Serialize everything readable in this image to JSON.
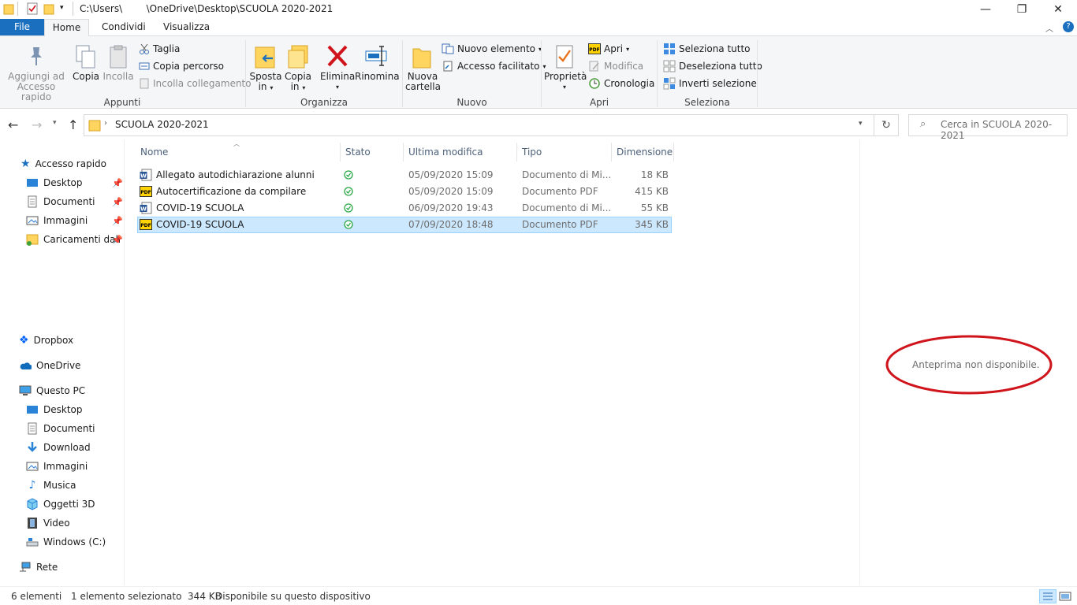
{
  "window": {
    "title": "C:\\Users\\        \\OneDrive\\Desktop\\SCUOLA 2020-2021",
    "minimize": "—",
    "maximize": "❐",
    "close": "✕"
  },
  "tabs": [
    {
      "label": "File"
    },
    {
      "label": "Home"
    },
    {
      "label": "Condividi"
    },
    {
      "label": "Visualizza"
    }
  ],
  "ribbon": {
    "appunti": {
      "pin_label_1": "Aggiungi ad",
      "pin_label_2": "Accesso rapido",
      "copy_label": "Copia",
      "paste_label": "Incolla",
      "cut_label": "Taglia",
      "copy_path_label": "Copia percorso",
      "paste_link_label": "Incolla collegamento",
      "group_label": "Appunti"
    },
    "organizza": {
      "move_label_1": "Sposta",
      "move_label_2": "in",
      "copyto_label_1": "Copia",
      "copyto_label_2": "in",
      "delete_label": "Elimina",
      "rename_label": "Rinomina",
      "group_label": "Organizza"
    },
    "nuovo": {
      "new_folder_1": "Nuova",
      "new_folder_2": "cartella",
      "new_item_label": "Nuovo elemento",
      "easy_access_label": "Accesso facilitato",
      "group_label": "Nuovo"
    },
    "apri": {
      "properties_label": "Proprietà",
      "open_label": "Apri",
      "edit_label": "Modifica",
      "history_label": "Cronologia",
      "group_label": "Apri"
    },
    "seleziona": {
      "select_all_label": "Seleziona tutto",
      "select_none_label": "Deseleziona tutto",
      "invert_label": "Inverti selezione",
      "group_label": "Seleziona"
    }
  },
  "address": {
    "path": "SCUOLA 2020-2021",
    "search_placeholder": "Cerca in SCUOLA 2020-2021"
  },
  "nav": {
    "quick_access": "Accesso rapido",
    "quick_items": [
      "Desktop",
      "Documenti",
      "Immagini",
      "Caricamenti dall"
    ],
    "dropbox": "Dropbox",
    "onedrive": "OneDrive",
    "this_pc": "Questo PC",
    "pc_items": [
      "Desktop",
      "Documenti",
      "Download",
      "Immagini",
      "Musica",
      "Oggetti 3D",
      "Video",
      "Windows (C:)"
    ],
    "network": "Rete"
  },
  "columns": {
    "name": "Nome",
    "status": "Stato",
    "modified": "Ultima modifica",
    "type": "Tipo",
    "size": "Dimensione"
  },
  "files": [
    {
      "name": "Allegato autodichiarazione alunni",
      "icon": "word-icon",
      "modified": "05/09/2020 15:09",
      "type": "Documento di Mi...",
      "size": "18 KB"
    },
    {
      "name": "Autocertificazione da compilare",
      "icon": "pdf-icon",
      "modified": "05/09/2020 15:09",
      "type": "Documento PDF",
      "size": "415 KB"
    },
    {
      "name": "COVID-19 SCUOLA",
      "icon": "word-icon",
      "modified": "06/09/2020 19:43",
      "type": "Documento di Mi...",
      "size": "55 KB"
    },
    {
      "name": "COVID-19 SCUOLA",
      "icon": "pdf-icon",
      "modified": "07/09/2020 18:48",
      "type": "Documento PDF",
      "size": "345 KB"
    }
  ],
  "preview": {
    "message": "Anteprima non disponibile."
  },
  "status": {
    "count": "6 elementi",
    "selection": "1 elemento selezionato  344 KB",
    "availability": "Disponibile su questo dispositivo"
  },
  "colors": {
    "accent": "#1a6fbf",
    "selection": "#cce8ff",
    "annotation": "#d0141c",
    "delete": "#d0141c"
  }
}
